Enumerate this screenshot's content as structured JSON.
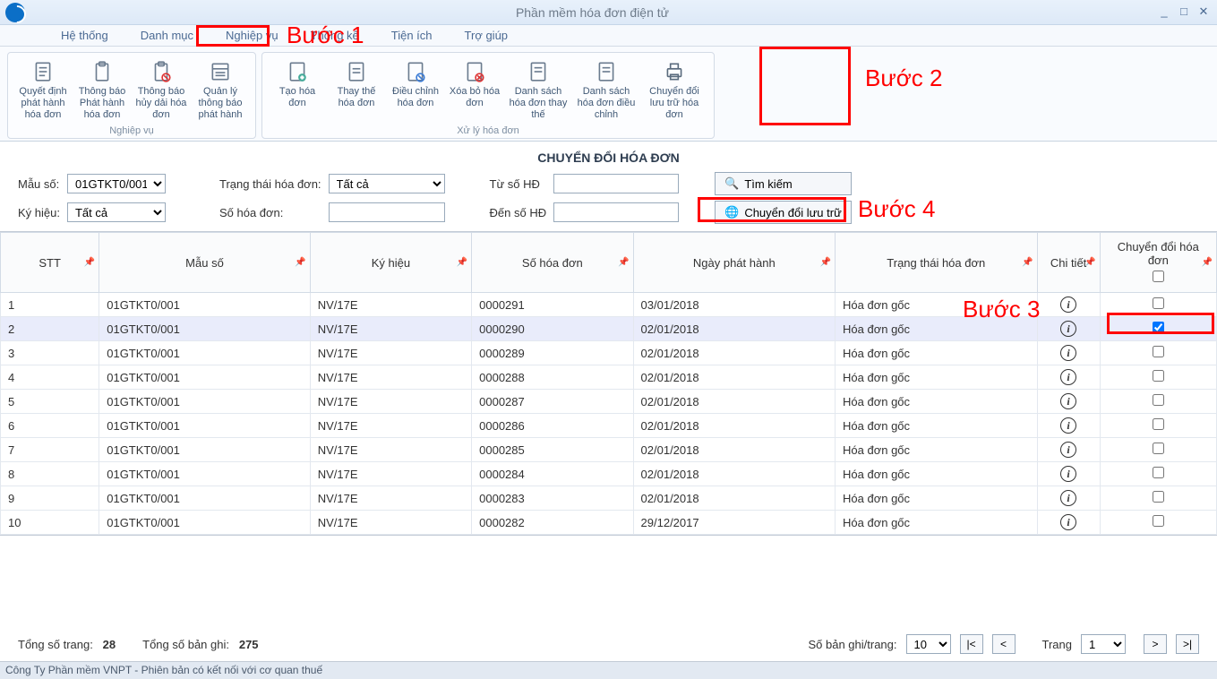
{
  "window": {
    "title": "Phần mềm hóa đơn điện tử"
  },
  "menu": {
    "items": [
      "Hệ thống",
      "Danh mục",
      "Nghiệp vụ",
      "Thống kê",
      "Tiện ích",
      "Trợ giúp"
    ]
  },
  "ribbon": {
    "group1": {
      "title": "Nghiệp vụ",
      "buttons": [
        {
          "label": "Quyết định phát hành hóa đơn"
        },
        {
          "label": "Thông báo Phát hành hóa đơn"
        },
        {
          "label": "Thông báo hủy dải hóa đơn"
        },
        {
          "label": "Quản lý thông báo phát hành"
        }
      ]
    },
    "group2": {
      "title": "Xử lý hóa đơn",
      "buttons": [
        {
          "label": "Tạo hóa đơn"
        },
        {
          "label": "Thay thế hóa đơn"
        },
        {
          "label": "Điều chỉnh hóa đơn"
        },
        {
          "label": "Xóa bỏ hóa đơn"
        },
        {
          "label": "Danh sách hóa đơn thay thế"
        },
        {
          "label": "Danh sách hóa đơn điều chỉnh"
        },
        {
          "label": "Chuyển đổi lưu trữ hóa đơn"
        }
      ]
    }
  },
  "page": {
    "title": "CHUYỂN ĐỔI HÓA ĐƠN"
  },
  "filters": {
    "mau_so_label": "Mẫu số:",
    "mau_so_value": "01GTKT0/001",
    "ky_hieu_label": "Ký hiệu:",
    "ky_hieu_value": "Tất cả",
    "trang_thai_label": "Trạng thái hóa đơn:",
    "trang_thai_value": "Tất cả",
    "so_hd_label": "Số hóa đơn:",
    "so_hd_value": "",
    "tu_so_label": "Từ số HĐ",
    "tu_so_value": "",
    "den_so_label": "Đến số HĐ",
    "den_so_value": "",
    "search_btn": "Tìm kiếm",
    "convert_btn": "Chuyển đổi lưu trữ"
  },
  "table": {
    "headers": [
      "STT",
      "Mẫu số",
      "Ký hiệu",
      "Số hóa đơn",
      "Ngày phát hành",
      "Trạng thái hóa đơn",
      "Chi tiết",
      "Chuyển đổi hóa đơn"
    ],
    "rows": [
      {
        "stt": "1",
        "mau": "01GTKT0/001",
        "kh": "NV/17E",
        "so": "0000291",
        "ngay": "03/01/2018",
        "tt": "Hóa đơn gốc",
        "chk": false
      },
      {
        "stt": "2",
        "mau": "01GTKT0/001",
        "kh": "NV/17E",
        "so": "0000290",
        "ngay": "02/01/2018",
        "tt": "Hóa đơn gốc",
        "chk": true
      },
      {
        "stt": "3",
        "mau": "01GTKT0/001",
        "kh": "NV/17E",
        "so": "0000289",
        "ngay": "02/01/2018",
        "tt": "Hóa đơn gốc",
        "chk": false
      },
      {
        "stt": "4",
        "mau": "01GTKT0/001",
        "kh": "NV/17E",
        "so": "0000288",
        "ngay": "02/01/2018",
        "tt": "Hóa đơn gốc",
        "chk": false
      },
      {
        "stt": "5",
        "mau": "01GTKT0/001",
        "kh": "NV/17E",
        "so": "0000287",
        "ngay": "02/01/2018",
        "tt": "Hóa đơn gốc",
        "chk": false
      },
      {
        "stt": "6",
        "mau": "01GTKT0/001",
        "kh": "NV/17E",
        "so": "0000286",
        "ngay": "02/01/2018",
        "tt": "Hóa đơn gốc",
        "chk": false
      },
      {
        "stt": "7",
        "mau": "01GTKT0/001",
        "kh": "NV/17E",
        "so": "0000285",
        "ngay": "02/01/2018",
        "tt": "Hóa đơn gốc",
        "chk": false
      },
      {
        "stt": "8",
        "mau": "01GTKT0/001",
        "kh": "NV/17E",
        "so": "0000284",
        "ngay": "02/01/2018",
        "tt": "Hóa đơn gốc",
        "chk": false
      },
      {
        "stt": "9",
        "mau": "01GTKT0/001",
        "kh": "NV/17E",
        "so": "0000283",
        "ngay": "02/01/2018",
        "tt": "Hóa đơn gốc",
        "chk": false
      },
      {
        "stt": "10",
        "mau": "01GTKT0/001",
        "kh": "NV/17E",
        "so": "0000282",
        "ngay": "29/12/2017",
        "tt": "Hóa đơn gốc",
        "chk": false
      }
    ]
  },
  "pager": {
    "total_pages_label": "Tổng số trang:",
    "total_pages": "28",
    "total_records_label": "Tổng số bản ghi:",
    "total_records": "275",
    "per_page_label": "Số bản ghi/trang:",
    "per_page": "10",
    "page_label": "Trang",
    "page": "1",
    "first": "|<",
    "prev": "<",
    "next": ">",
    "last": ">|"
  },
  "status": {
    "text": "Công Ty Phần mềm VNPT - Phiên bản có kết nối với cơ quan thuế"
  },
  "annotations": {
    "b1": "Bước 1",
    "b2": "Bước 2",
    "b3": "Bước 3",
    "b4": "Bước 4"
  }
}
